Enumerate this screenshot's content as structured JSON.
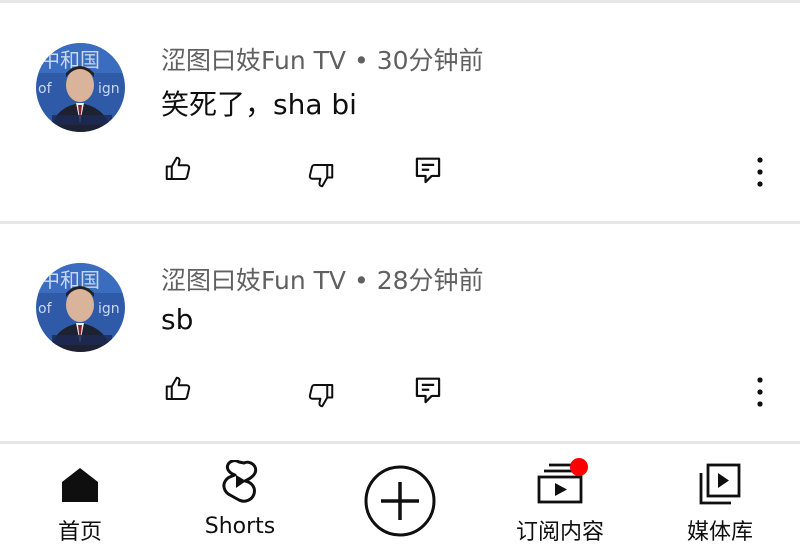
{
  "comments": [
    {
      "author": "涩图曰妓Fun TV",
      "separator": "•",
      "time": "30分钟前",
      "text": "笑死了，sha bi"
    },
    {
      "author": "涩图曰妓Fun TV",
      "separator": "•",
      "time": "28分钟前",
      "text": "sb"
    }
  ],
  "icons": {
    "like": "thumbs-up-icon",
    "dislike": "thumbs-down-icon",
    "reply": "reply-comment-icon",
    "more": "more-vertical-icon"
  },
  "nav": {
    "items": [
      {
        "label": "首页",
        "icon": "home-icon"
      },
      {
        "label": "Shorts",
        "icon": "shorts-icon"
      },
      {
        "label": "",
        "icon": "create-plus-icon"
      },
      {
        "label": "订阅内容",
        "icon": "subscriptions-icon",
        "badge_color": "#ff0000"
      },
      {
        "label": "媒体库",
        "icon": "library-icon"
      }
    ]
  }
}
